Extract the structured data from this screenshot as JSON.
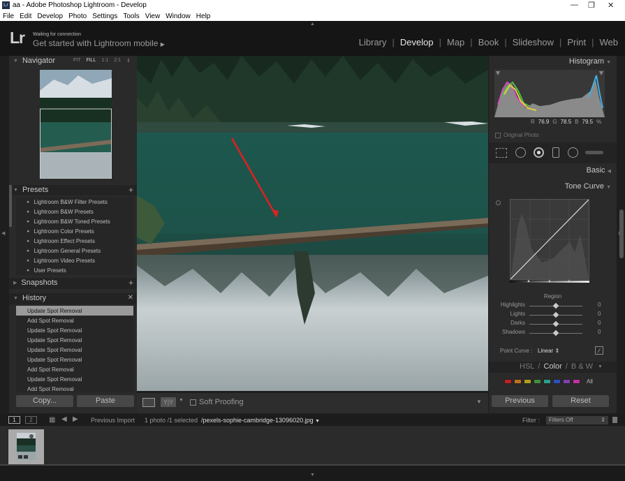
{
  "window": {
    "title": "aa - Adobe Photoshop Lightroom - Develop",
    "icon_text": "Lr"
  },
  "menu": [
    "File",
    "Edit",
    "Develop",
    "Photo",
    "Settings",
    "Tools",
    "View",
    "Window",
    "Help"
  ],
  "identity": {
    "logo": "Lr",
    "status": "Waiting for connection",
    "mobile": "Get started with Lightroom mobile"
  },
  "modules": [
    {
      "label": "Library",
      "active": false
    },
    {
      "label": "Develop",
      "active": true
    },
    {
      "label": "Map",
      "active": false
    },
    {
      "label": "Book",
      "active": false
    },
    {
      "label": "Slideshow",
      "active": false
    },
    {
      "label": "Print",
      "active": false
    },
    {
      "label": "Web",
      "active": false
    }
  ],
  "navigator": {
    "title": "Navigator",
    "zoom": [
      "FIT",
      "FILL",
      "1:1",
      "2:1"
    ],
    "active_zoom": "FILL"
  },
  "presets": {
    "title": "Presets",
    "items": [
      "Lightroom B&W Filter Presets",
      "Lightroom B&W Presets",
      "Lightroom B&W Toned Presets",
      "Lightroom Color Presets",
      "Lightroom Effect Presets",
      "Lightroom General Presets",
      "Lightroom Video Presets",
      "User Presets"
    ]
  },
  "snapshots": {
    "title": "Snapshots"
  },
  "history": {
    "title": "History",
    "items": [
      "Update Spot Removal",
      "Add Spot Removal",
      "Update Spot Removal",
      "Update Spot Removal",
      "Update Spot Removal",
      "Update Spot Removal",
      "Add Spot Removal",
      "Update Spot Removal",
      "Add Spot Removal"
    ],
    "selected_index": 0
  },
  "left_buttons": {
    "copy": "Copy...",
    "paste": "Paste"
  },
  "toolbar": {
    "view_compare": "Y|Y",
    "soft_proofing": "Soft Proofing"
  },
  "histogram": {
    "title": "Histogram",
    "r_label": "R",
    "r": "76.9",
    "g_label": "G",
    "g": "78.5",
    "b_label": "B",
    "b": "79.5",
    "pct": "%",
    "original_photo": "Original Photo"
  },
  "basic": {
    "title": "Basic"
  },
  "tone_curve": {
    "title": "Tone Curve",
    "region_title": "Region",
    "regions": [
      {
        "label": "Highlights",
        "value": "0",
        "level": 0.5
      },
      {
        "label": "Lights",
        "value": "0",
        "level": 0.5
      },
      {
        "label": "Darks",
        "value": "0",
        "level": 0.5
      },
      {
        "label": "Shadows",
        "value": "0",
        "level": 0.5
      }
    ],
    "point_curve_label": "Point Curve :",
    "point_curve_value": "Linear"
  },
  "hsl": {
    "hsl": "HSL",
    "color": "Color",
    "bw": "B & W",
    "all": "All",
    "swatches": [
      "#c02020",
      "#c07020",
      "#b0a020",
      "#409040",
      "#30a090",
      "#3050c0",
      "#8040b0",
      "#c030a0"
    ]
  },
  "right_buttons": {
    "previous": "Previous",
    "reset": "Reset"
  },
  "filmstrip": {
    "screen1": "1",
    "screen2": "2",
    "source": "Previous Import",
    "count": "1 photo /1 selected",
    "filename": "/pexels-sophie-cambridge-13096020.jpg",
    "filter_label": "Filter :",
    "filter_value": "Filters Off"
  },
  "colors": {
    "accent_arrow": "#e02020",
    "panel_bg": "#2a2a2a",
    "app_bg": "#1e1e1e"
  }
}
